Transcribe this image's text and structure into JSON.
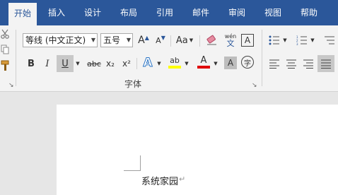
{
  "tabs": [
    "开始",
    "插入",
    "设计",
    "布局",
    "引用",
    "邮件",
    "审阅",
    "视图",
    "帮助"
  ],
  "font": {
    "name_value": "等线 (中文正文)",
    "size_value": "五号",
    "grow_label": "A",
    "shrink_label": "A",
    "case_label": "Aa",
    "phonetic_top": "wén",
    "phonetic_bottom": "文",
    "border_char_label": "A",
    "bold_label": "B",
    "italic_label": "I",
    "underline_label": "U",
    "strike_label": "abc",
    "subscript_label": "x₂",
    "superscript_label": "x²",
    "effects_label": "A",
    "highlight_label": "ab",
    "font_color_label": "A",
    "shading_label": "A",
    "enclose_label": "字",
    "group_label": "字体"
  },
  "document": {
    "text": "系统家园"
  },
  "colors": {
    "accent": "#2b579a",
    "highlight": "#ffff00",
    "font_color": "#e00000"
  }
}
